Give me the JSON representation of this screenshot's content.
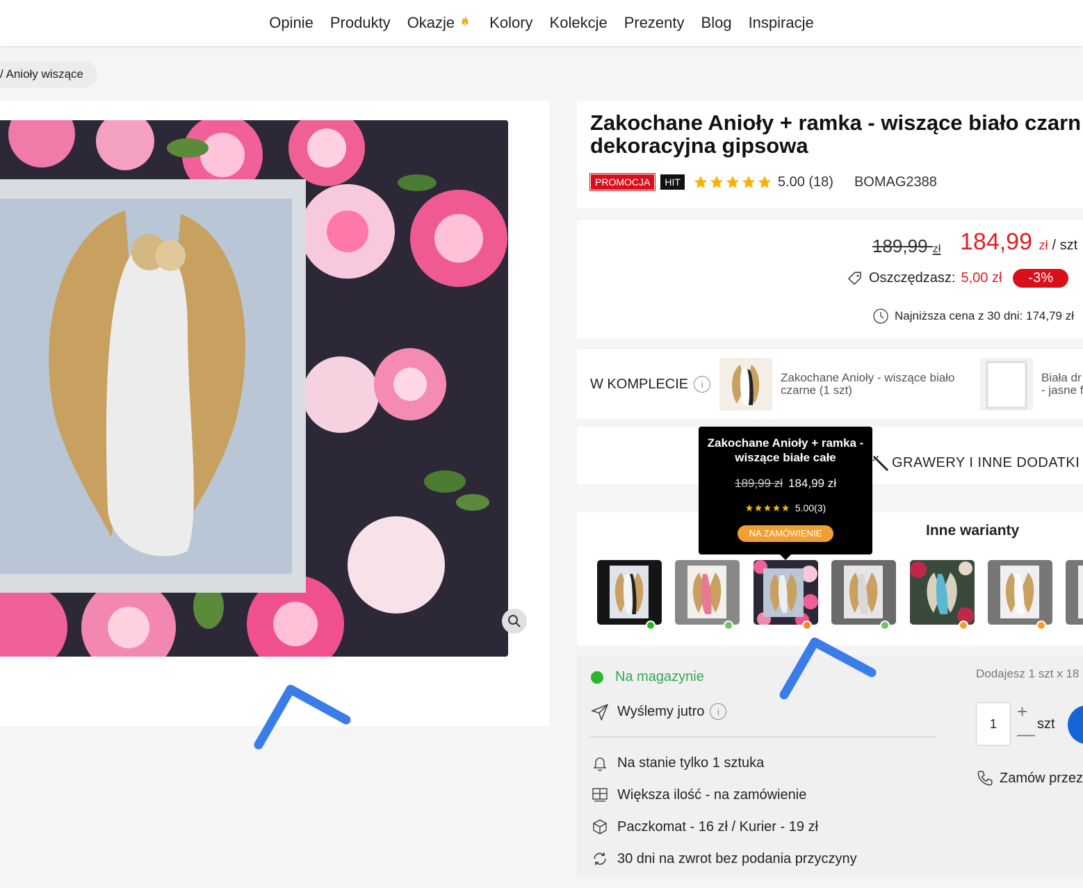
{
  "nav": {
    "items": [
      "Opinie",
      "Produkty",
      "Okazje",
      "Kolory",
      "Kolekcje",
      "Prezenty",
      "Blog",
      "Inspiracje"
    ]
  },
  "breadcrumb": "/ Anioły wiszące",
  "product": {
    "title_line1": "Zakochane Anioły + ramka - wiszące biało czarn",
    "title_line2": "dekoracyjna gipsowa",
    "badge_promo": "PROMOCJA",
    "badge_hit": "HIT",
    "rating_text": "5.00 (18)",
    "rating_stars": 5,
    "sku": "BOMAG2388"
  },
  "price": {
    "old_value": "189,99",
    "old_currency": "zł",
    "new_value": "184,99",
    "new_currency": "zł",
    "per_unit": "/ szt",
    "savings_label": "Oszczędzasz:",
    "savings_amount": "5,00 zł",
    "discount": "-3%",
    "lowest_30_days": "Najniższa cena z 30 dni: 174,79 zł"
  },
  "bundle": {
    "label": "W KOMPLECIE",
    "info": "i",
    "item1_line1": "Zakochane Anioły - wiszące biało",
    "item1_line2": "czarne (1 szt)",
    "item2_line1": "Biała dr",
    "item2_line2": "- jasne f"
  },
  "engrave": {
    "label": "GRAWERY I INNE DODATKI"
  },
  "variants": {
    "title": "Inne warianty",
    "dot_colors": [
      "#2cb52c",
      "#6cc46c",
      "#f08a24",
      "#6cc46c",
      "#f0a030",
      "#f0a030"
    ]
  },
  "tooltip": {
    "title": "Zakochane Anioły + ramka - wiszące białe całe",
    "old_price": "189,99 zł",
    "new_price": "184,99 zł",
    "rating": "5.00(3)",
    "status": "NA ZAMÓWIENIE"
  },
  "stock": {
    "availability": "Na magazynie",
    "shipping": "Wyślemy jutro",
    "only_one": "Na stanie tylko 1 sztuka",
    "bulk": "Większa ilość - na zamówienie",
    "delivery": "Paczkomat - 16 zł / Kurier - 19 zł",
    "returns": "30 dni na zwrot bez podania przyczyny",
    "adding": "Dodajesz 1 szt x 18",
    "qty": "1",
    "plus": "+",
    "minus": "—",
    "unit": "szt",
    "order_phone": "Zamów przez"
  },
  "colors": {
    "accent_red": "#e31e24",
    "in_stock_green": "#2cb52c",
    "cart_blue": "#1565d8",
    "annotation_blue": "#3b7de8"
  }
}
